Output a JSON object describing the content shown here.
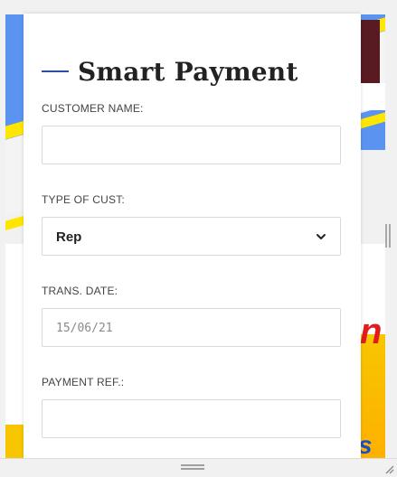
{
  "form": {
    "title": "Smart Payment",
    "fields": {
      "customer_name": {
        "label": "CUSTOMER NAME:",
        "value": "",
        "placeholder": ""
      },
      "type_of_cust": {
        "label": "TYPE OF CUST:",
        "selected": "Rep"
      },
      "trans_date": {
        "label": "TRANS. DATE:",
        "value": "15/06/21"
      },
      "payment_ref": {
        "label": "PAYMENT REF.:",
        "value": "",
        "placeholder": ""
      }
    }
  },
  "background_letters": {
    "red": "n",
    "blue": "s"
  },
  "colors": {
    "accent_rule": "#2b4ea2",
    "bg_blue": "#5b94f0",
    "bg_yellow": "#ffe600"
  },
  "icons": [
    "chevron-down-icon",
    "resize-grip-icon",
    "vertical-handle-icon",
    "horizontal-handle-icon"
  ]
}
